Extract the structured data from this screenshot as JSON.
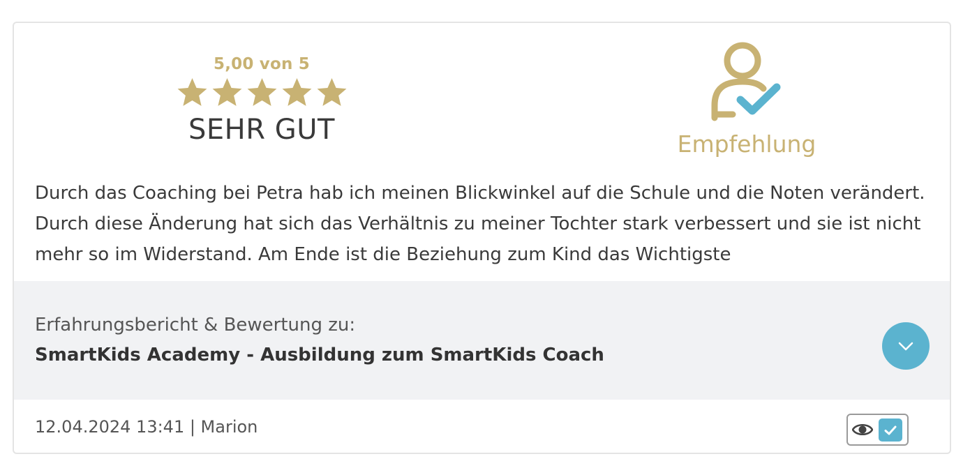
{
  "rating": {
    "score_text": "5,00 von 5",
    "stars": 5,
    "label": "SEHR GUT"
  },
  "recommendation": {
    "icon": "user-check-icon",
    "label": "Empfehlung"
  },
  "review": {
    "text": "Durch das Coaching bei Petra hab ich meinen Blickwinkel auf die Schule und die Noten verändert. Durch diese Änderung hat sich das Verhältnis zu meiner Tochter stark verbessert und sie ist nicht mehr so im Widerstand. Am Ende ist die Beziehung zum Kind das Wichtigste"
  },
  "product": {
    "intro": "Erfahrungsbericht & Bewertung zu:",
    "name": "SmartKids Academy - Ausbildung zum SmartKids Coach",
    "toggle_icon": "chevron-down-icon"
  },
  "footer": {
    "meta": "12.04.2024 13:41 | Marion",
    "badge_icons": [
      "eye-icon",
      "check-icon"
    ]
  },
  "colors": {
    "gold": "#c8b273",
    "accent": "#5bb3cf",
    "panel": "#f1f2f4"
  }
}
